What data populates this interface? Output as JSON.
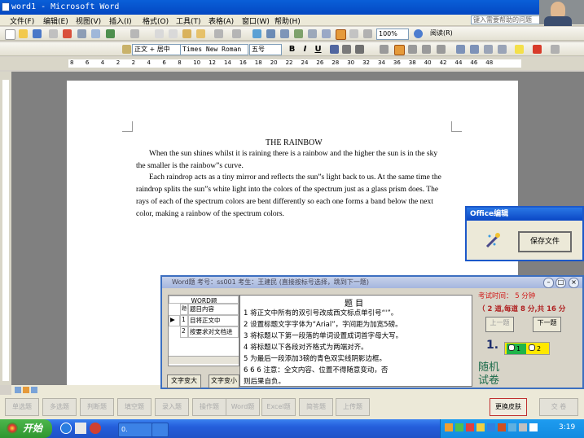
{
  "window": {
    "title": "word1 - Microsoft Word"
  },
  "menu": {
    "items": [
      "文件(F)",
      "编辑(E)",
      "视图(V)",
      "插入(I)",
      "格式(O)",
      "工具(T)",
      "表格(A)",
      "窗口(W)",
      "帮助(H)"
    ],
    "help_placeholder": "键入需要帮助的问题"
  },
  "toolbar": {
    "zoom": "100%",
    "reading": "阅读(R)",
    "style": "正文 + 居中",
    "font": "Times New Roman",
    "size": "五号",
    "bold": "B",
    "italic": "I",
    "underline": "U"
  },
  "ruler": {
    "numbers": [
      "8",
      "6",
      "4",
      "2",
      "2",
      "4",
      "6",
      "8",
      "10",
      "12",
      "14",
      "16",
      "18",
      "20",
      "22",
      "24",
      "26",
      "28",
      "30",
      "32",
      "34",
      "36",
      "38",
      "40",
      "42",
      "44",
      "46",
      "48"
    ]
  },
  "document": {
    "title": "THE RAINBOW",
    "lines": [
      "When the sun shines whilst it is raining there is a rainbow and the higher the sun is in the sky",
      "the smaller is the rainbow”s curve.",
      "Each raindrop acts as a tiny mirror and reflects the sun”s light back to us. At the same time the",
      "raindrop splits the sun”s white light into the colors of the spectrum just as a glass prism does. The",
      "rays of each of the spectrum colors are bent differently so each one forms a band below the next",
      "color, making a rainbow of the spectrum colors."
    ]
  },
  "office_window": {
    "title": "Office编辑",
    "save_button": "保存文件"
  },
  "exam": {
    "caption": "Word题    考号：ss001    考生：王建民    (直接按标号选择，跳到下一题)",
    "grid_header": "WORD题",
    "grid_col_num": "题号",
    "grid_col_content": "题目内容",
    "grid_rows": [
      {
        "num": "1",
        "content": "目将正文中"
      },
      {
        "num": "2",
        "content": "按要求对文档进"
      }
    ],
    "task_title": "题  目",
    "tasks": [
      "1    将正文中所有的双引号改成西文标点单引号“'”。",
      "2    设置标题文字字体为“Arial”，字间距为加宽5磅。",
      "3    将标题以下第一段落的单词设置成词首字母大写。",
      "4    将标题以下各段对齐格式为两端对齐。",
      "5    为最后一段添加3磅的青色双实线阴影边框。",
      "6         6         6       注意：全文内容、位置不得随意变动，否",
      "则后果自负。"
    ],
    "time_label": "考试时间：  5  分钟",
    "score_label": "（ 2 道,每道  8 分,共 16 分",
    "prev_button": "上一题",
    "next_button": "下一题",
    "question_number": "1.",
    "radio1": "1",
    "radio2": "2",
    "random_label_1": "随机",
    "random_label_2": "试卷",
    "text_larger": "文字变大",
    "text_smaller": "文字变小"
  },
  "question_types": [
    "单选题",
    "多选题",
    "判断题",
    "填空题",
    "录入题",
    "操作题",
    "Word题",
    "Excel题",
    "简答题",
    "上传题"
  ],
  "switch_skin": "更换皮肤",
  "submit": "交 卷",
  "taskbar": {
    "start": "开始",
    "item": "0.",
    "clock": "3:19"
  }
}
